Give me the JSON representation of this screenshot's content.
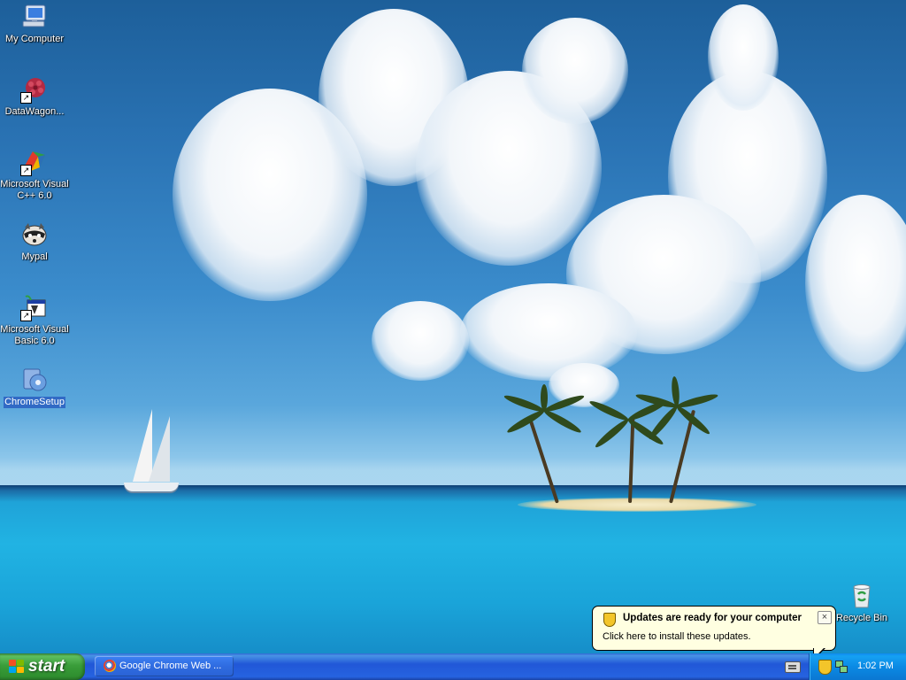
{
  "desktop": {
    "icons": [
      {
        "label": "My Computer",
        "icon": "my-computer-icon"
      },
      {
        "label": "DataWagon...",
        "icon": "datawagon-icon"
      },
      {
        "label": "Microsoft Visual C++ 6.0",
        "icon": "visual-cpp-icon"
      },
      {
        "label": "Mypal",
        "icon": "mypal-raccoon-icon"
      },
      {
        "label": "Microsoft Visual Basic 6.0",
        "icon": "visual-basic-icon"
      },
      {
        "label": "ChromeSetup",
        "icon": "chrome-setup-icon"
      },
      {
        "label": "Recycle Bin",
        "icon": "recycle-bin-icon"
      }
    ]
  },
  "balloon": {
    "title": "Updates are ready for your computer",
    "body": "Click here to install these updates.",
    "close": "×"
  },
  "taskbar": {
    "start_label": "start",
    "tasks": [
      {
        "label": "Google Chrome Web ...",
        "icon": "chrome-setup-icon"
      }
    ],
    "clock": "1:02 PM"
  },
  "colors": {
    "taskbar_blue": "#2157d7",
    "start_green": "#3a9d3a",
    "tray_blue": "#0b8ae4",
    "balloon_bg": "#ffffe1",
    "selection_blue": "#316ac5"
  }
}
